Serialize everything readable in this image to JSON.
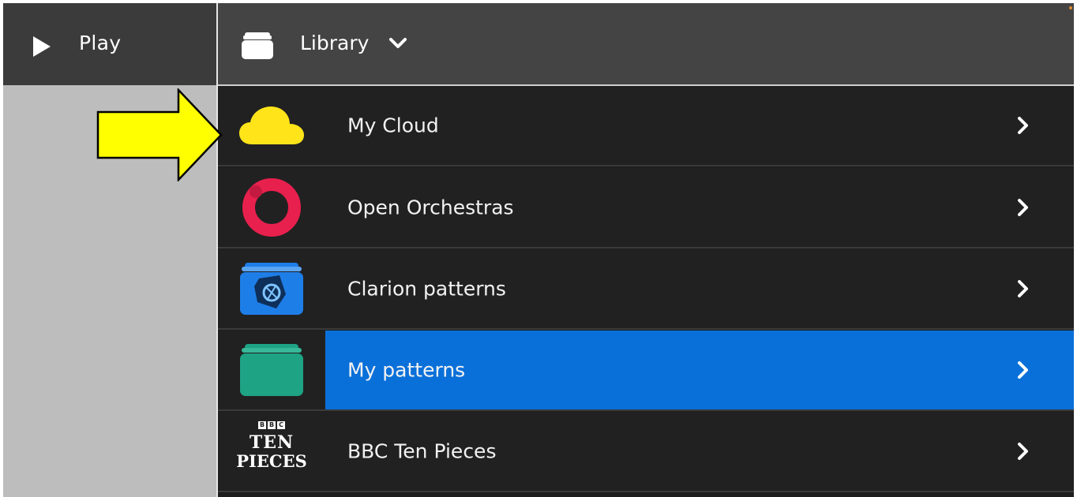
{
  "toolbar": {
    "play_label": "Play",
    "library_label": "Library"
  },
  "library": {
    "items": [
      {
        "label": "My Cloud",
        "icon": "cloud-icon",
        "color": "#ffe41a"
      },
      {
        "label": "Open Orchestras",
        "icon": "open-orchestras-logo-icon",
        "color": "#e8204d"
      },
      {
        "label": "Clarion patterns",
        "icon": "clarion-folder-icon",
        "color": "#1e7ee8"
      },
      {
        "label": "My patterns",
        "icon": "folder-icon",
        "color": "#1ea385",
        "selected": true
      },
      {
        "label": "BBC Ten Pieces",
        "icon": "ten-pieces-logo-icon"
      }
    ],
    "ten_pieces_logo": {
      "bbc": [
        "B",
        "B",
        "C"
      ],
      "line1": "TEN",
      "line2": "PIECES"
    }
  },
  "colors": {
    "selection": "#0a70d9",
    "annotation_arrow": "#ffff00"
  }
}
